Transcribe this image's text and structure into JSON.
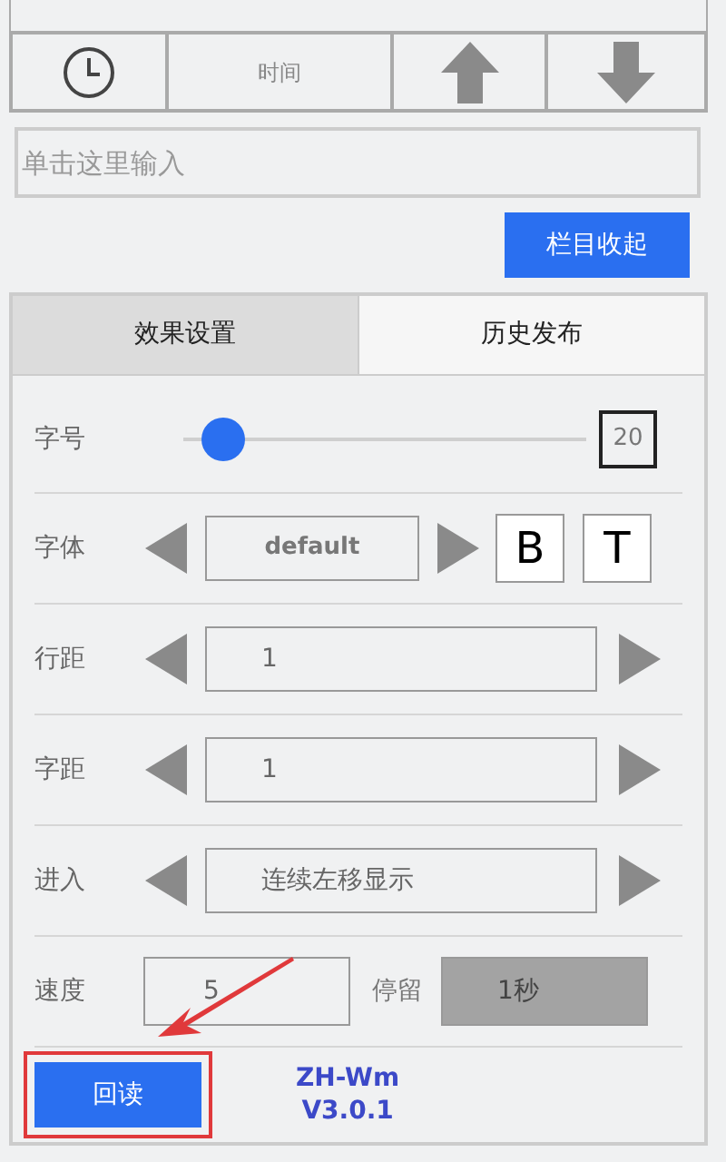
{
  "toolbar": {
    "time_label": "时间"
  },
  "input": {
    "placeholder": "单击这里输入"
  },
  "collapse_button": "栏目收起",
  "tabs": [
    {
      "label": "效果设置",
      "selected": true
    },
    {
      "label": "历史发布",
      "selected": false
    }
  ],
  "rows": [
    {
      "kind": "slider",
      "label": "字号",
      "level": 0.05,
      "value": "20"
    },
    {
      "kind": "font",
      "label": "字体",
      "value": "default",
      "bold_label": "B",
      "type_label": "T"
    },
    {
      "kind": "stepper",
      "label": "行距",
      "value": "1"
    },
    {
      "kind": "stepper",
      "label": "字距",
      "value": "1"
    },
    {
      "kind": "stepper",
      "label": "进入",
      "value": "连续左移显示"
    },
    {
      "kind": "speed",
      "label": "速度",
      "value": "5",
      "stay_label": "停留",
      "stay_value": "1秒"
    }
  ],
  "readback_button": "回读",
  "app_name": "ZH-Wm",
  "version": "V3.0.1"
}
